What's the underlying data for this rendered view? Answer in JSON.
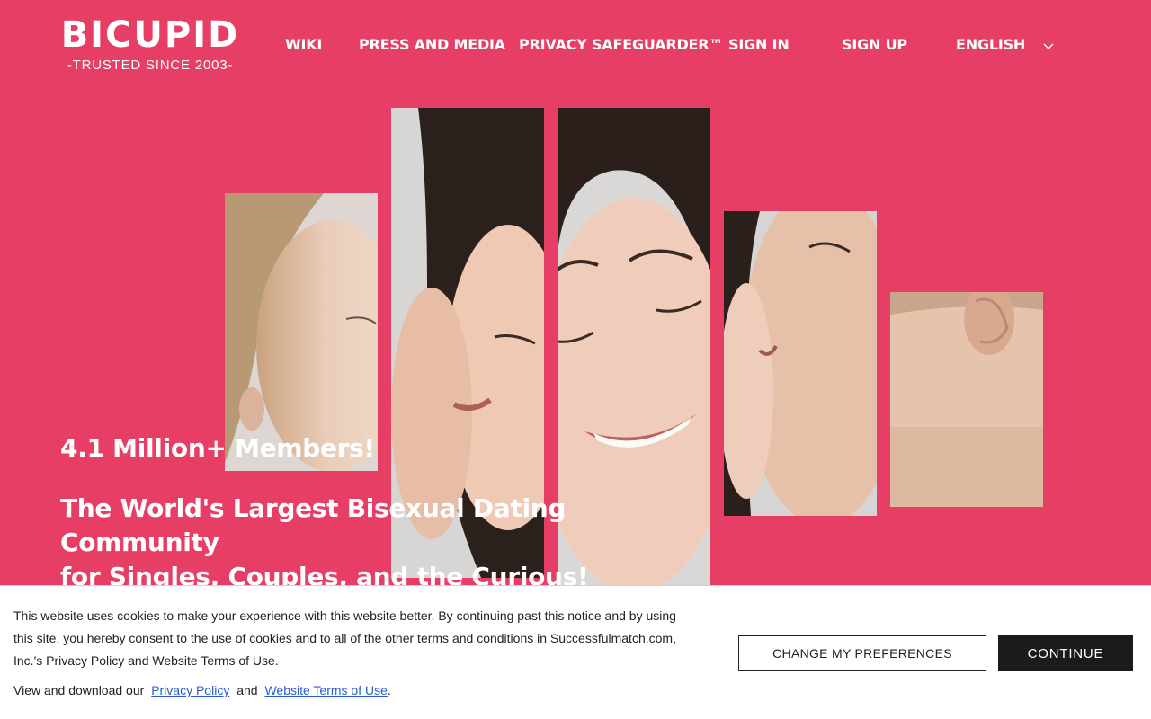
{
  "header": {
    "logo_name": "BICUPID",
    "logo_tagline": "-TRUSTED SINCE 2003-",
    "nav": {
      "wiki": "WIKI",
      "press": "PRESS AND MEDIA",
      "privacy": "PRIVACY SAFEGUARDER™",
      "signin": "SIGN IN",
      "signup": "SIGN UP",
      "language": "ENGLISH"
    },
    "language_icon": "chevron-down-icon"
  },
  "hero": {
    "members": "4.1 Million+ Members!",
    "tagline_line1": "The World's Largest Bisexual Dating Community",
    "tagline_line2": "for Singles, Couples, and the Curious!"
  },
  "cookie": {
    "line1": "This website uses cookies to make your experience with this website better. By continuing past this notice and by using",
    "line2": "this site, you hereby consent to the use of cookies and to all of the other terms and conditions in Successfulmatch.com,",
    "line3": "Inc.'s Privacy Policy and Website Terms of Use.",
    "download_prefix": "View and download our",
    "privacy_link": "Privacy Policy",
    "and": "and",
    "terms_link": "Website Terms of Use",
    "period": ".",
    "preferences_button": "CHANGE MY PREFERENCES",
    "continue_button": "CONTINUE"
  },
  "colors": {
    "brand": "#e63e65",
    "button_dark": "#1b1b1b",
    "link": "#2a5bd7"
  }
}
